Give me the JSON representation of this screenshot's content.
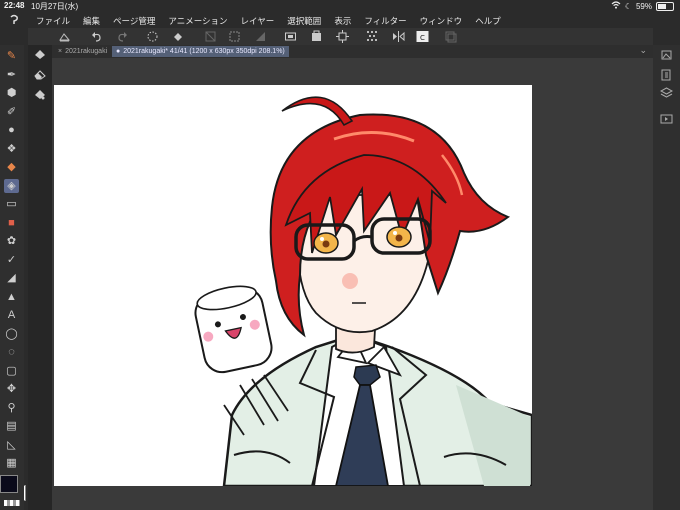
{
  "status": {
    "time": "22:48",
    "date": "10月27日(水)",
    "battery": "59%",
    "battery_level": 0.59
  },
  "menu": {
    "items": [
      "ファイル",
      "編集",
      "ページ管理",
      "アニメーション",
      "レイヤー",
      "選択範囲",
      "表示",
      "フィルター",
      "ウィンドウ",
      "ヘルプ"
    ]
  },
  "tabs": [
    {
      "label": "2021rakugaki",
      "active": false
    },
    {
      "label": "2021rakugaki* 41/41 (1200 x 630px 350dpi 208.1%)",
      "active": true
    }
  ],
  "colors": {
    "main": "#0a0a1a",
    "sub": "#ffffff",
    "selected_tool": "#5e6a90",
    "active_tab": "#546077"
  },
  "icons": {
    "leftbar": [
      "tool-property-icon",
      "pen-icon",
      "eraser-icon",
      "fill-icon",
      "blend-icon",
      "airbrush-icon",
      "decoration-icon",
      "select-tool-icon",
      "eraser2-icon",
      "figure-icon",
      "brush-icon",
      "eyedropper-icon",
      "gradient-icon",
      "paint-icon",
      "text-icon",
      "balloon-icon",
      "lasso-icon",
      "marquee-icon",
      "move-icon",
      "zoom-icon",
      "layer-move-icon",
      "ruler-icon",
      "color-icon"
    ]
  }
}
